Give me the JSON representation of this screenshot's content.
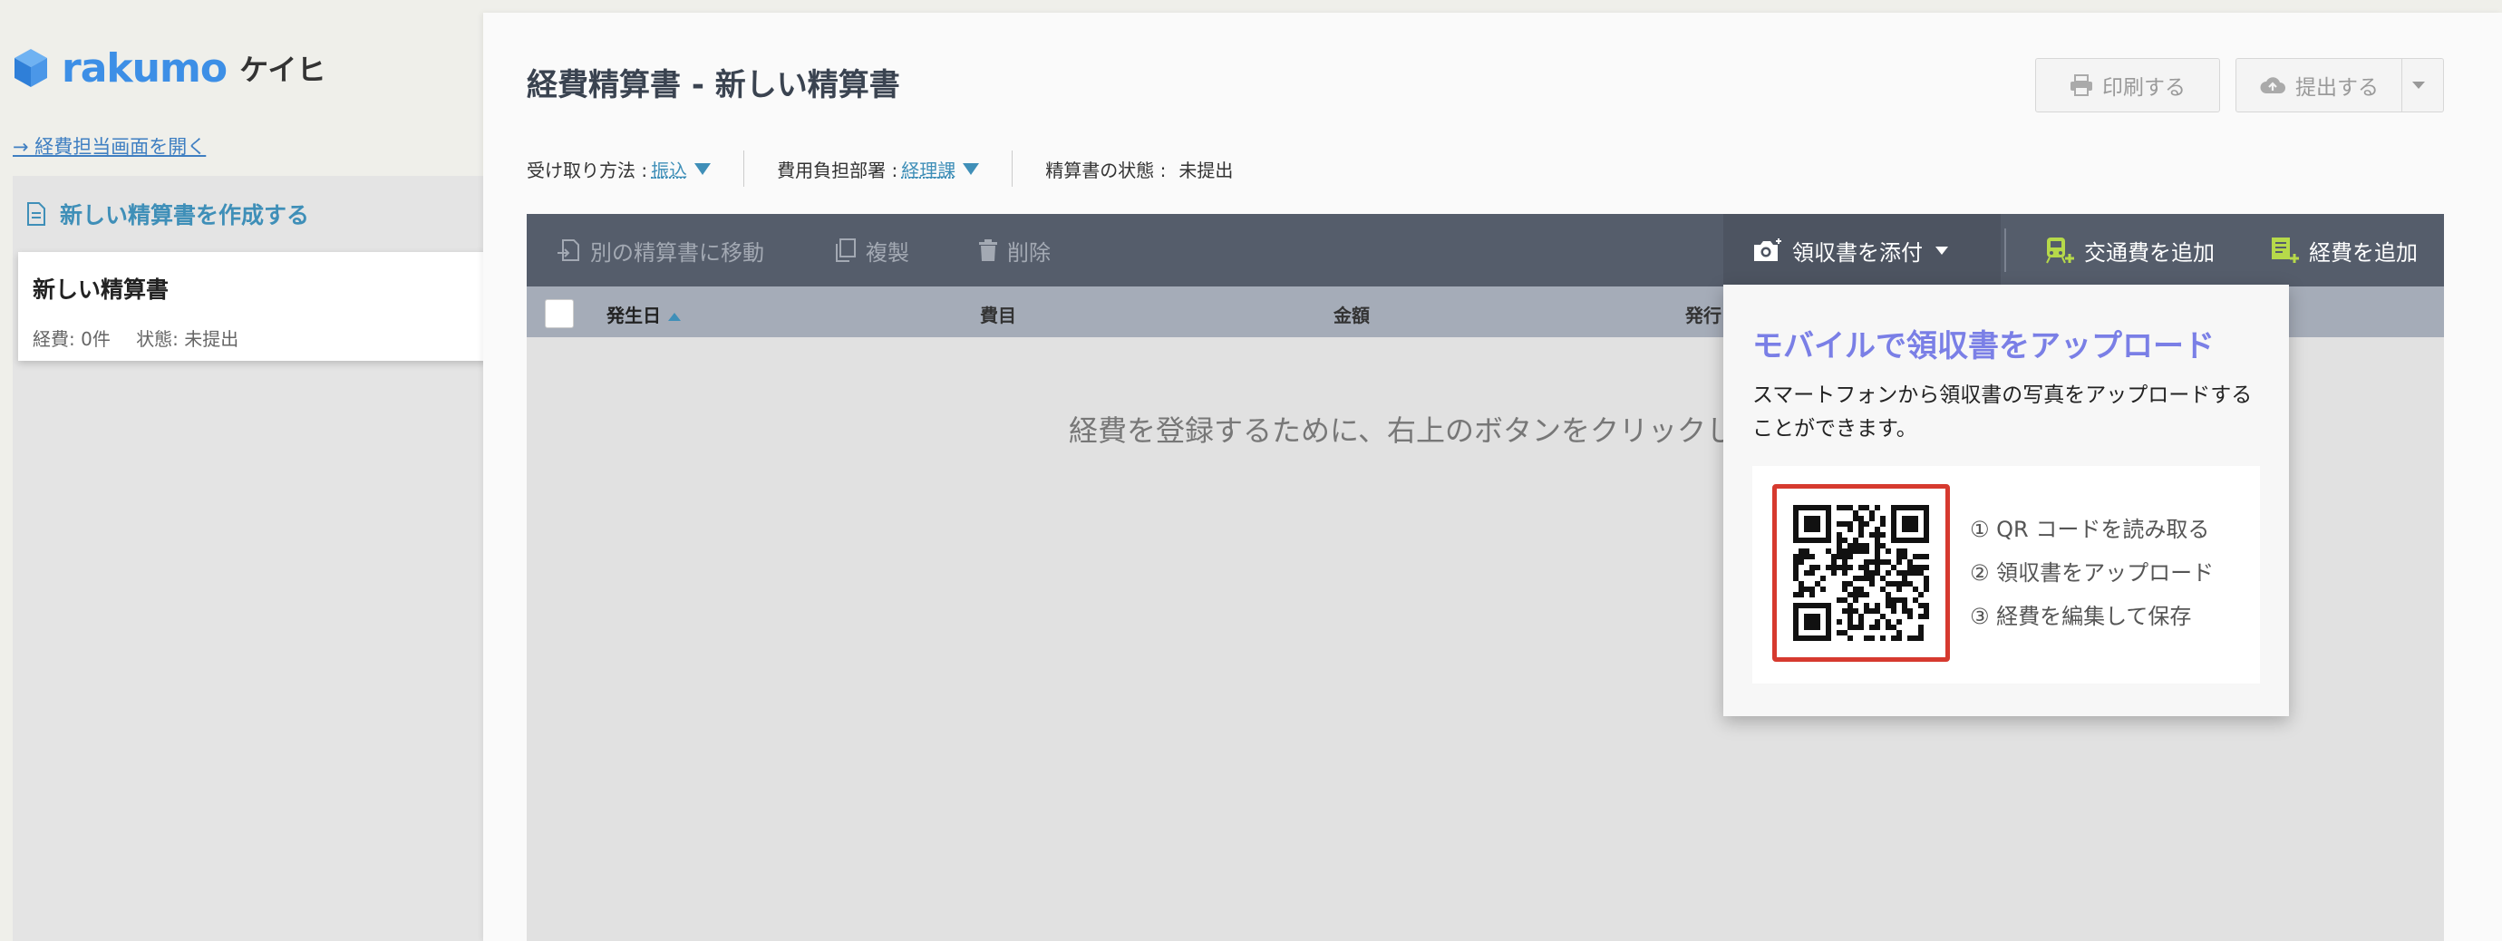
{
  "app": {
    "logo_text": "rakumo",
    "logo_sub": "ケイヒ",
    "admin_link": "→ 経費担当画面を開く"
  },
  "sidebar": {
    "create_label": "新しい精算書を作成する",
    "reports": [
      {
        "title": "新しい精算書",
        "count_label": "経費: 0件",
        "status_label": "状態: 未提出"
      }
    ]
  },
  "header": {
    "title": "経費精算書 - 新しい精算書",
    "print_label": "印刷する",
    "submit_label": "提出する"
  },
  "meta": {
    "receipt_method_label": "受け取り方法 :",
    "receipt_method_value": "振込",
    "department_label": "費用負担部署 :",
    "department_value": "経理課",
    "status_label": "精算書の状態 :",
    "status_value": "未提出"
  },
  "toolbar": {
    "move_label": "別の精算書に移動",
    "copy_label": "複製",
    "delete_label": "削除",
    "attach_label": "領収書を添付",
    "transport_label": "交通費を追加",
    "expense_label": "経費を追加"
  },
  "table": {
    "columns": [
      "発生日",
      "費目",
      "金額",
      "発行"
    ],
    "empty_message": "経費を登録するために、右上のボタンをクリックし"
  },
  "popover": {
    "title": "モバイルで領収書をアップロード",
    "description": "スマートフォンから領収書の写真をアップロードすることができます。",
    "steps": [
      "① QR コードを読み取る",
      "② 領収書をアップロード",
      "③ 経費を編集して保存"
    ]
  },
  "colors": {
    "accent_link": "#3f8fb8",
    "toolbar_bg": "#555d6b",
    "popover_title": "#7a7fe6",
    "qr_border": "#d63a2f",
    "icon_green": "#b6d94a"
  }
}
